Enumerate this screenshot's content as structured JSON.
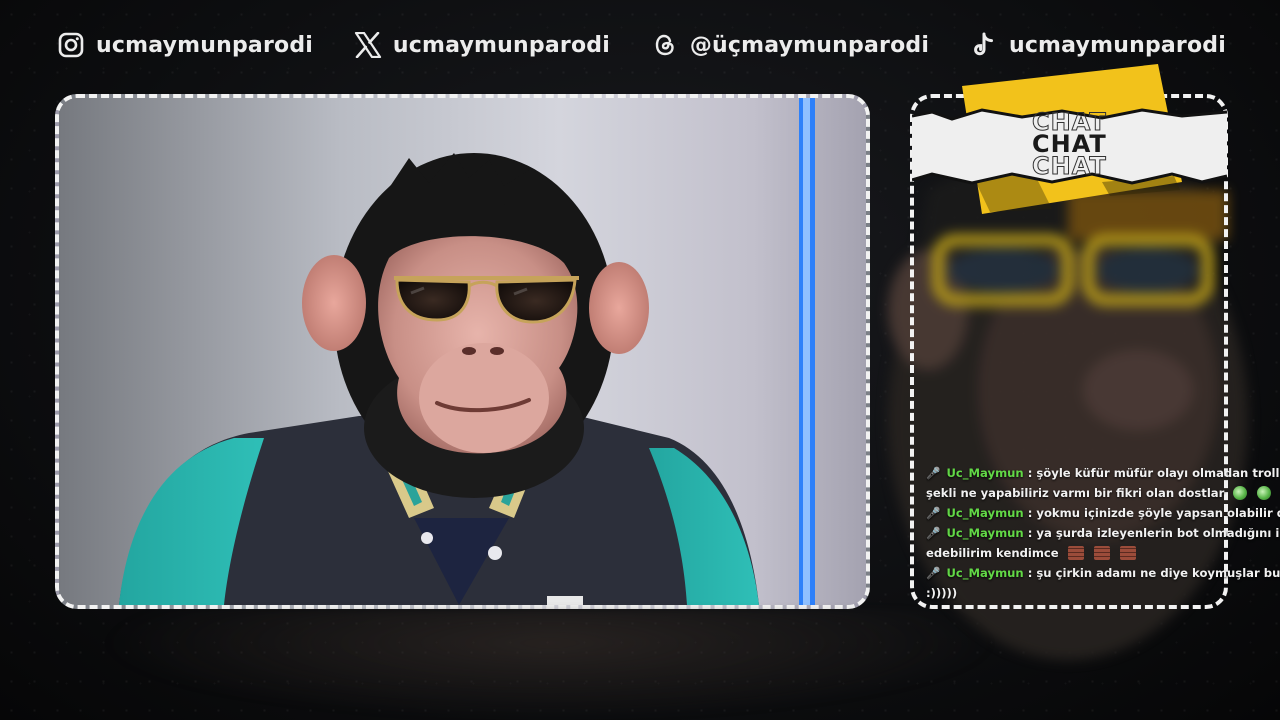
{
  "social": [
    {
      "platform": "instagram",
      "icon": "instagram-icon",
      "label": "ucmaymunparodi"
    },
    {
      "platform": "x",
      "icon": "x-logo-icon",
      "label": "ucmaymunparodi"
    },
    {
      "platform": "threads",
      "icon": "threads-icon",
      "label": "@üçmaymunparodi"
    },
    {
      "platform": "tiktok",
      "icon": "tiktok-icon",
      "label": "ucmaymunparodi"
    }
  ],
  "chat": {
    "header_word": "CHAT",
    "messages": [
      {
        "icon": "microphone-icon",
        "user": "Uc_Maymun",
        "separator": ":",
        "lines": [
          "şöyle küfür müfür olayı olmadan trollerin bulaşm",
          "şekli ne yapabiliriz varmı bir fikri olan dostlar"
        ],
        "emotes": [
          "green-blob-emote",
          "green-blob-emote",
          "green-blob-emote"
        ]
      },
      {
        "icon": "microphone-icon",
        "user": "Uc_Maymun",
        "separator": ":",
        "lines": [
          "yokmu içinizde şöyle yapsan olabilir diyecek kin"
        ],
        "emotes": []
      },
      {
        "icon": "microphone-icon",
        "user": "Uc_Maymun",
        "separator": ":",
        "lines": [
          "ya şurda izleyenlerin bot olmadığını ispet edemi",
          "edebilirim kendimce"
        ],
        "emotes": [
          "brick-emote",
          "brick-emote",
          "brick-emote"
        ]
      },
      {
        "icon": "microphone-icon",
        "user": "Uc_Maymun",
        "separator": ":",
        "lines": [
          "şu çirkin adamı ne diye koymuşlar buraya ya ne",
          ":)))))"
        ],
        "emotes": []
      }
    ]
  },
  "colors": {
    "username": "#62d846",
    "mic": "#b04be0",
    "frame_border": "#f2f2f2",
    "chat_header_yellow": "#f2c21b",
    "accent_light_strip": "#1f7bff"
  }
}
